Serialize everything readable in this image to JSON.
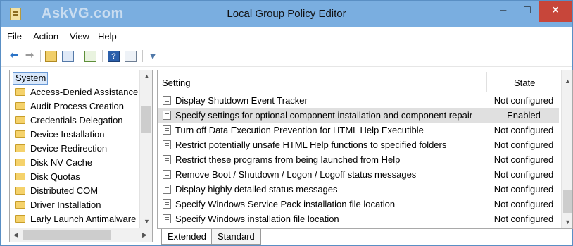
{
  "window": {
    "title": "Local Group Policy Editor",
    "watermark": "AskVG.com",
    "min_glyph": "–",
    "max_glyph": "□",
    "close_glyph": "×"
  },
  "menu": [
    "File",
    "Action",
    "View",
    "Help"
  ],
  "toolbar": {
    "icons": [
      "back-arrow-icon",
      "forward-arrow-icon",
      "up-folder-icon",
      "show-hide-tree-icon",
      "export-list-icon",
      "help-icon",
      "view-icon",
      "filter-icon"
    ]
  },
  "tree": {
    "root": "System",
    "items": [
      "Access-Denied Assistance",
      "Audit Process Creation",
      "Credentials Delegation",
      "Device Installation",
      "Device Redirection",
      "Disk NV Cache",
      "Disk Quotas",
      "Distributed COM",
      "Driver Installation",
      "Early Launch Antimalware"
    ]
  },
  "details": {
    "col_setting": "Setting",
    "col_state": "State",
    "rows": [
      {
        "name": "Display Shutdown Event Tracker",
        "state": "Not configured"
      },
      {
        "name": "Specify settings for optional component installation and component repair",
        "state": "Enabled"
      },
      {
        "name": "Turn off Data Execution Prevention for HTML Help Executible",
        "state": "Not configured"
      },
      {
        "name": "Restrict potentially unsafe HTML Help functions to specified folders",
        "state": "Not configured"
      },
      {
        "name": "Restrict these programs from being launched from Help",
        "state": "Not configured"
      },
      {
        "name": "Remove Boot / Shutdown / Logon / Logoff status messages",
        "state": "Not configured"
      },
      {
        "name": "Display highly detailed status messages",
        "state": "Not configured"
      },
      {
        "name": "Specify Windows Service Pack installation file location",
        "state": "Not configured"
      },
      {
        "name": "Specify Windows installation file location",
        "state": "Not configured"
      }
    ]
  },
  "tabs": [
    "Extended",
    "Standard"
  ]
}
